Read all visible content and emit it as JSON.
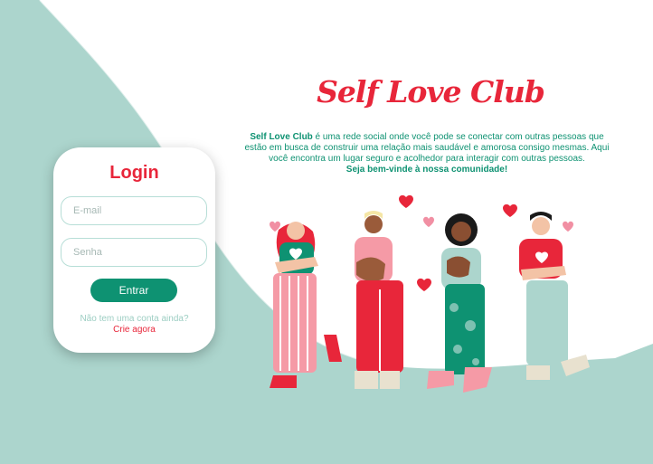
{
  "brand": {
    "title": "Self Love Club"
  },
  "description": {
    "brand_name": "Self Love Club",
    "text": " é uma rede social onde você pode se conectar com outras pessoas que estão em busca de construir uma relação mais saudável e amorosa consigo mesmas. Aqui você encontra um lugar seguro e acolhedor para interagir com outras pessoas.",
    "welcome": "Seja bem-vinde à nossa comunidade!"
  },
  "login": {
    "title": "Login",
    "email_placeholder": "E-mail",
    "password_placeholder": "Senha",
    "submit_label": "Entrar",
    "no_account_text": "Não tem uma conta ainda?",
    "create_link": "Crie agora"
  },
  "colors": {
    "accent_red": "#e8263a",
    "accent_green": "#0e9272",
    "mint_background": "#acd5cd"
  },
  "illustration": {
    "icons": [
      "heart-icon",
      "person-illustration"
    ]
  }
}
